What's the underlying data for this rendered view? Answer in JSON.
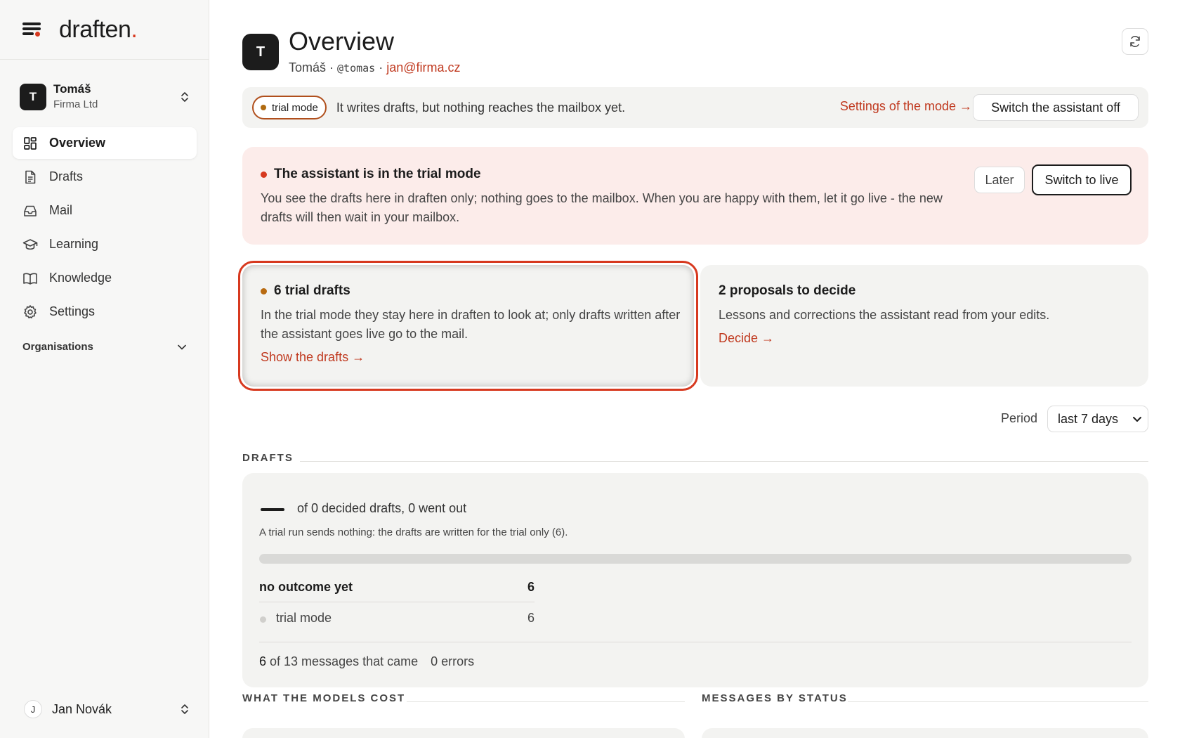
{
  "brand": {
    "name": "draften",
    "dot": "."
  },
  "account": {
    "initial": "T",
    "name": "Tomáš",
    "org": "Firma Ltd"
  },
  "nav": [
    {
      "label": "Overview",
      "icon": "grid-icon",
      "active": true
    },
    {
      "label": "Drafts",
      "icon": "document-icon",
      "active": false
    },
    {
      "label": "Mail",
      "icon": "inbox-icon",
      "active": false
    },
    {
      "label": "Learning",
      "icon": "graduation-cap-icon",
      "active": false
    },
    {
      "label": "Knowledge",
      "icon": "book-icon",
      "active": false
    },
    {
      "label": "Settings",
      "icon": "gear-icon",
      "active": false
    }
  ],
  "organisations": {
    "label": "Organisations"
  },
  "user": {
    "initial": "J",
    "name": "Jan Novák"
  },
  "header": {
    "initial": "T",
    "title": "Overview",
    "name": "Tomáš",
    "sep1": " · ",
    "handle": "@tomas",
    "sep2": " · ",
    "email": "jan@firma.cz"
  },
  "modebar": {
    "pill": "trial mode",
    "text": "It writes drafts, but nothing reaches the mailbox yet.",
    "settings_link": "Settings of the mode →",
    "switch_off": "Switch the assistant off"
  },
  "alert": {
    "title": "The assistant is in the trial mode",
    "body": "You see the drafts here in draften only; nothing goes to the mailbox. When you are happy with them, let it go live - the new drafts will then wait in your mailbox.",
    "later": "Later",
    "live": "Switch to live"
  },
  "cards": {
    "trial": {
      "title": "6 trial drafts",
      "body": "In the trial mode they stay here in draften to look at; only drafts written after the assistant goes live go to the mail.",
      "link": "Show the drafts →"
    },
    "proposals": {
      "title": "2 proposals to decide",
      "body": "Lessons and corrections the assistant read from your edits.",
      "link": "Decide →"
    }
  },
  "period": {
    "label": "Period",
    "selected": "last 7 days"
  },
  "sections": {
    "drafts": "DRAFTS",
    "cost": "WHAT THE MODELS COST",
    "status": "MESSAGES BY STATUS"
  },
  "drafts": {
    "decided": "of 0 decided drafts, 0 went out",
    "note": "A trial run sends nothing: the drafts are written for the trial only (6).",
    "sent_fraction": 0,
    "rows": [
      {
        "label": "no outcome yet",
        "value": "6"
      },
      {
        "label": "trial mode",
        "value": "6"
      }
    ],
    "totals": {
      "count": "6",
      "of_text": " of 13 messages that came",
      "errors": "0 errors"
    }
  }
}
